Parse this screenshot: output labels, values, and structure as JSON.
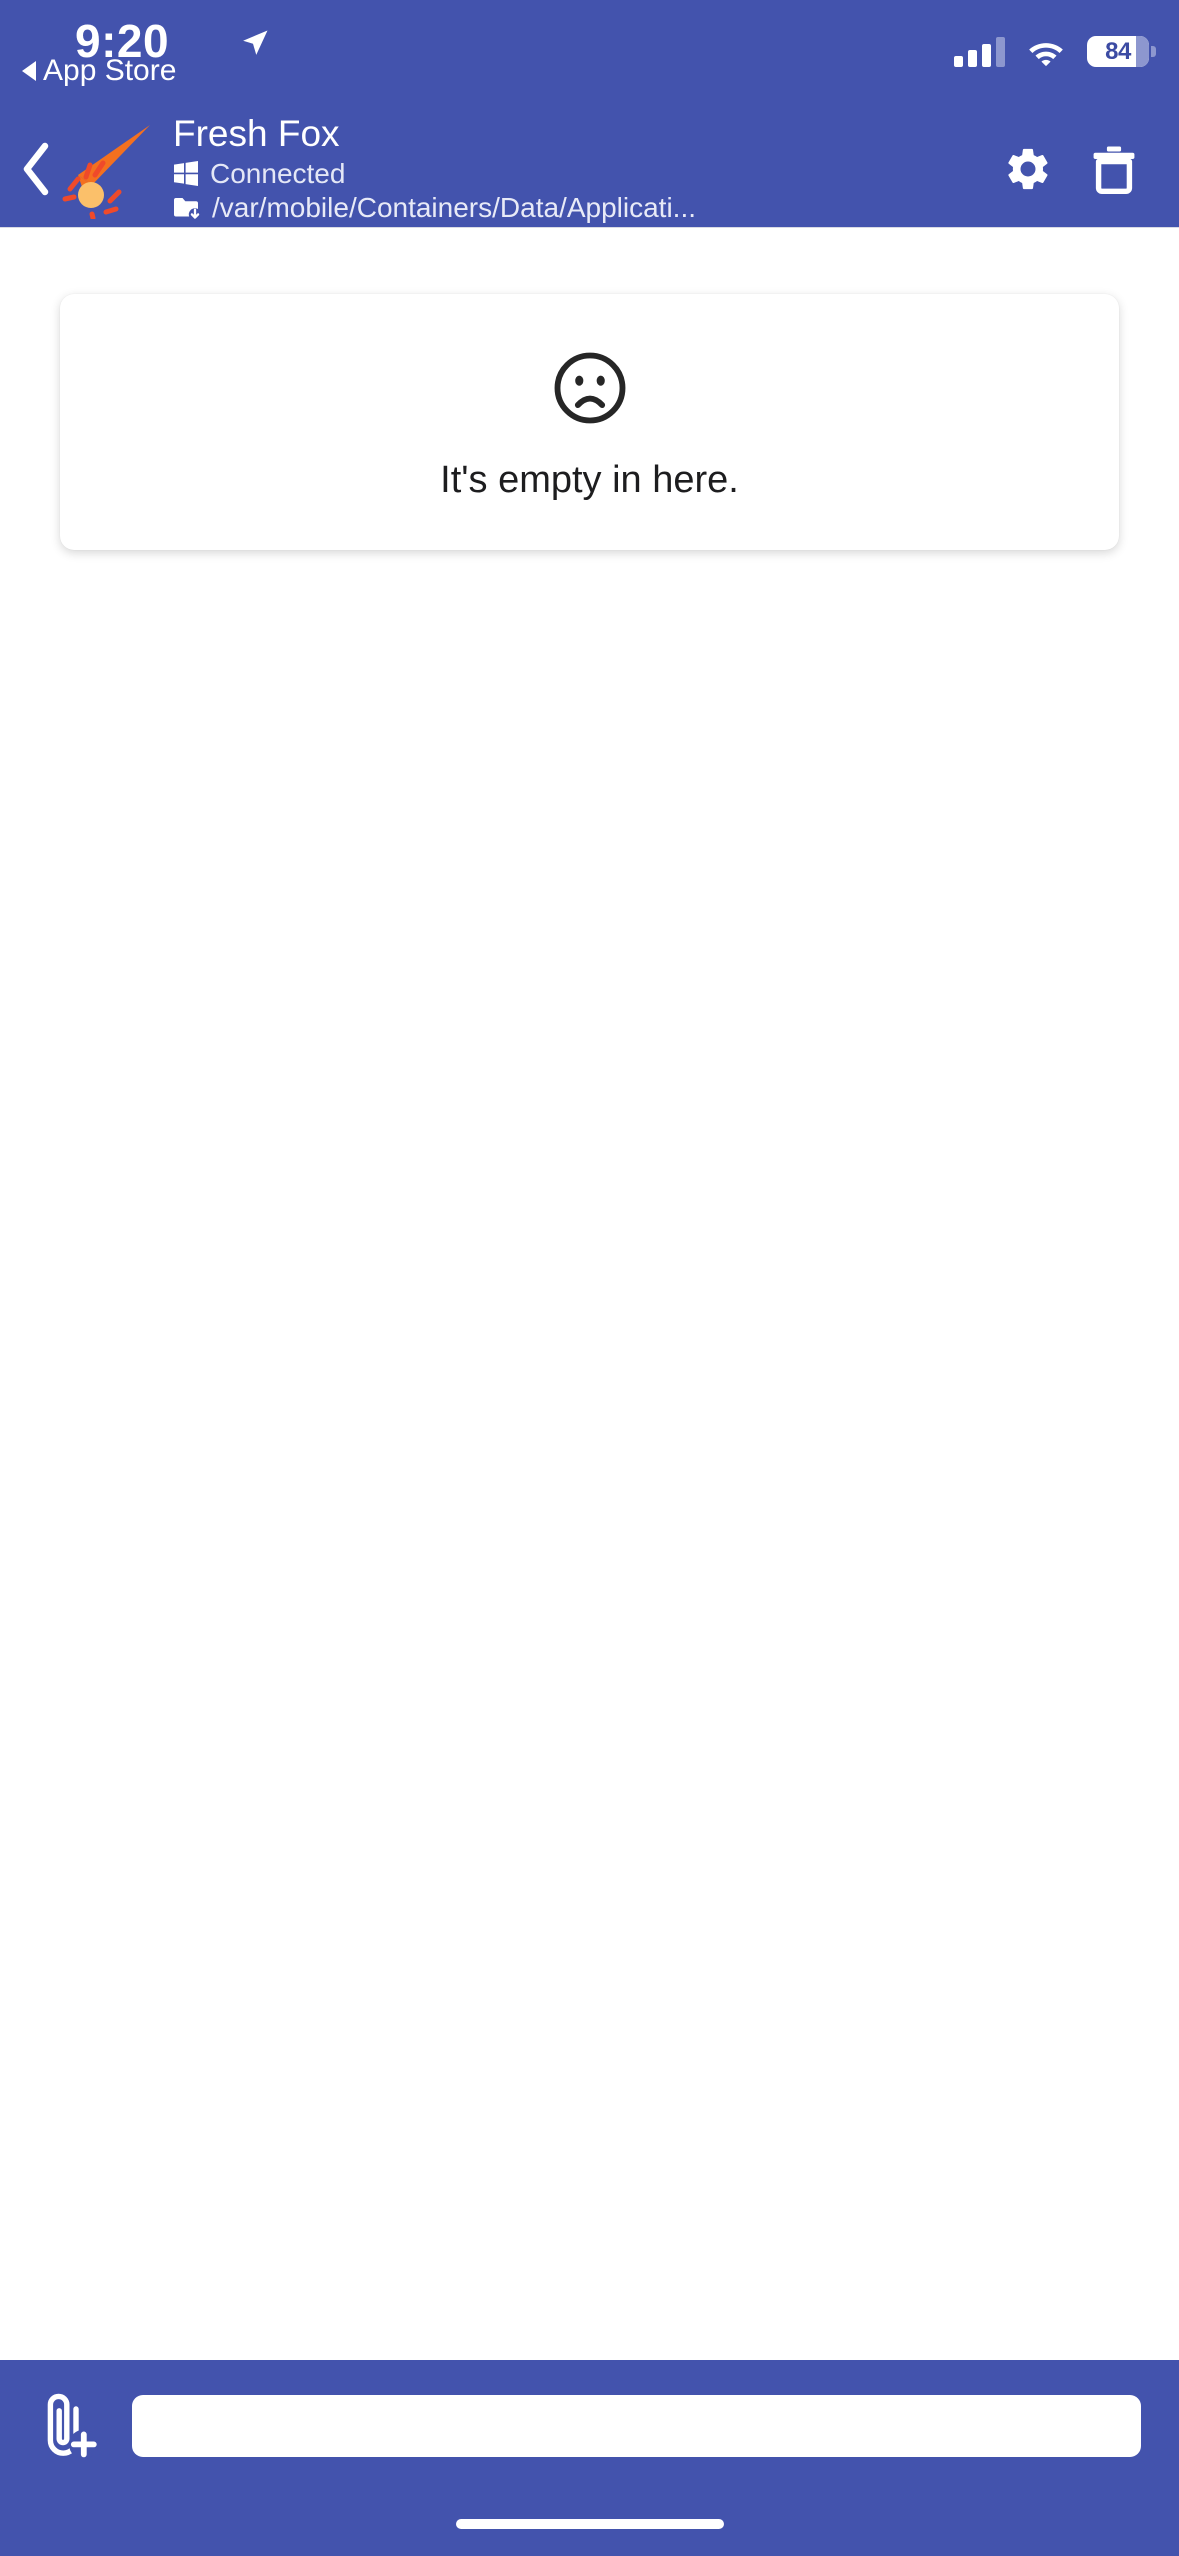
{
  "theme": {
    "accent": "#4353ad",
    "accent_dark": "#3c4ba3",
    "logo_orange": "#f4701f",
    "logo_red": "#ef4a2a",
    "logo_yellow": "#fbc06a",
    "content_bg": "#ffffff",
    "muted_text": "#e4e7f6"
  },
  "statusbar": {
    "time": "9:20",
    "location_icon": "location-arrow-icon",
    "back_app_label": "App Store",
    "back_app_icon": "back-triangle-icon",
    "signal_icon": "cellular-signal-icon",
    "signal_bars_filled": 3,
    "signal_bars_total": 4,
    "wifi_icon": "wifi-icon",
    "battery_icon": "battery-icon",
    "battery_percent": "84"
  },
  "appbar": {
    "back_icon": "chevron-left-icon",
    "logo_icon": "comet-logo-icon",
    "title": "Fresh Fox",
    "status_icon": "windows-logo-icon",
    "status_label": "Connected",
    "path_icon": "folder-download-icon",
    "path_label": "/var/mobile/Containers/Data/Applicati...",
    "settings_icon": "gear-icon",
    "settings_label": "Settings",
    "delete_icon": "trash-icon",
    "delete_label": "Delete"
  },
  "main": {
    "empty_state": {
      "icon": "frowning-face-icon",
      "message": "It's empty in here."
    }
  },
  "toolbar": {
    "attach_icon": "paperclip-plus-icon",
    "attach_label": "Attach file",
    "message_input_value": "",
    "message_input_placeholder": ""
  },
  "home_indicator": {
    "icon": "home-bar-indicator"
  }
}
